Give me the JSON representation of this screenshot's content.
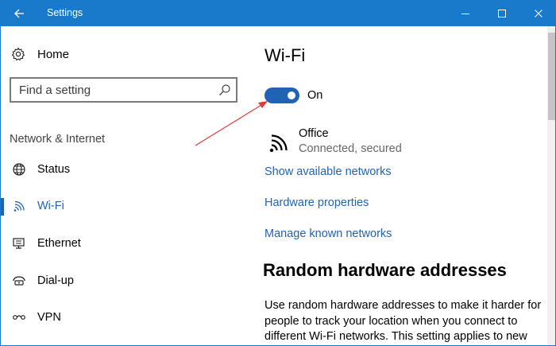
{
  "window": {
    "title": "Settings",
    "accent_color": "#1979ca",
    "link_color": "#1f63b5"
  },
  "sidebar": {
    "home_label": "Home",
    "search": {
      "placeholder": "Find a setting"
    },
    "section_title": "Network & Internet",
    "items": [
      {
        "label": "Status",
        "icon": "globe-icon",
        "active": false
      },
      {
        "label": "Wi-Fi",
        "icon": "wifi-icon",
        "active": true
      },
      {
        "label": "Ethernet",
        "icon": "ethernet-icon",
        "active": false
      },
      {
        "label": "Dial-up",
        "icon": "dialup-icon",
        "active": false
      },
      {
        "label": "VPN",
        "icon": "vpn-icon",
        "active": false
      }
    ]
  },
  "main": {
    "title": "Wi-Fi",
    "toggle": {
      "state": "On",
      "on": true
    },
    "network": {
      "name": "Office",
      "status": "Connected, secured",
      "icon": "wifi-signal-icon"
    },
    "links": [
      "Show available networks",
      "Hardware properties",
      "Manage known networks"
    ],
    "section_heading": "Random hardware addresses",
    "description": "Use random hardware addresses to make it harder for people to track your location when you connect to different Wi-Fi networks. This setting applies to new"
  },
  "annotation": {
    "type": "red-arrow",
    "color": "#e03a3a"
  }
}
